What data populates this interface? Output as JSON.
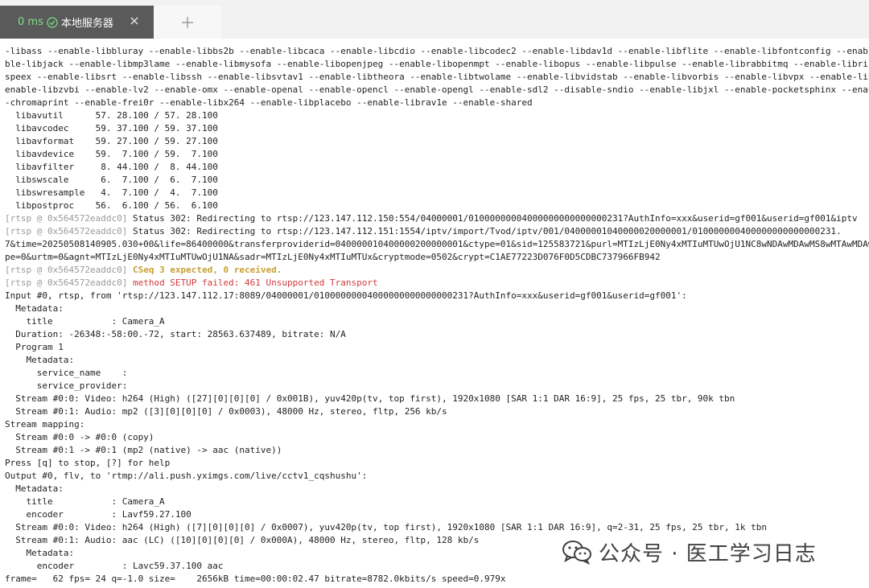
{
  "tab": {
    "latency": "0 ms",
    "label": "本地服务器",
    "close": "×"
  },
  "watermark": "公众号 · 医工学习日志",
  "colors": {
    "tab_bg": "#5a5a5a",
    "latency": "#7ee08a",
    "warn": "#c8a032",
    "error": "#d23a3a",
    "tag": "#9a9a9a"
  },
  "lines": [
    {
      "kind": "plain",
      "text": "-libass --enable-libbluray --enable-libbs2b --enable-libcaca --enable-libcdio --enable-libcodec2 --enable-libdav1d --enable-libflite --enable-libfontconfig --enabl"
    },
    {
      "kind": "plain",
      "text": "ble-libjack --enable-libmp3lame --enable-libmysofa --enable-libopenjpeg --enable-libopenmpt --enable-libopus --enable-libpulse --enable-librabbitmq --enable-libris"
    },
    {
      "kind": "plain",
      "text": "speex --enable-libsrt --enable-libssh --enable-libsvtav1 --enable-libtheora --enable-libtwolame --enable-libvidstab --enable-libvorbis --enable-libvpx --enable-lib"
    },
    {
      "kind": "plain",
      "text": "enable-libzvbi --enable-lv2 --enable-omx --enable-openal --enable-opencl --enable-opengl --enable-sdl2 --disable-sndio --enable-libjxl --enable-pocketsphinx --enab"
    },
    {
      "kind": "plain",
      "text": "-chromaprint --enable-frei0r --enable-libx264 --enable-libplacebo --enable-librav1e --enable-shared"
    },
    {
      "kind": "plain",
      "text": "  libavutil      57. 28.100 / 57. 28.100"
    },
    {
      "kind": "plain",
      "text": "  libavcodec     59. 37.100 / 59. 37.100"
    },
    {
      "kind": "plain",
      "text": "  libavformat    59. 27.100 / 59. 27.100"
    },
    {
      "kind": "plain",
      "text": "  libavdevice    59.  7.100 / 59.  7.100"
    },
    {
      "kind": "plain",
      "text": "  libavfilter     8. 44.100 /  8. 44.100"
    },
    {
      "kind": "plain",
      "text": "  libswscale      6.  7.100 /  6.  7.100"
    },
    {
      "kind": "plain",
      "text": "  libswresample   4.  7.100 /  4.  7.100"
    },
    {
      "kind": "plain",
      "text": "  libpostproc    56.  6.100 / 56.  6.100"
    },
    {
      "kind": "rtsp",
      "tag": "[rtsp @ 0x564572eaddc0]",
      "text": " Status 302: Redirecting to rtsp://123.147.112.150:554/04000001/01000000004000000000000000231?AuthInfo=xxx&userid=gf001&userid=gf001&iptv"
    },
    {
      "kind": "rtsp",
      "tag": "[rtsp @ 0x564572eaddc0]",
      "text": " Status 302: Redirecting to rtsp://123.147.112.151:1554/iptv/import/Tvod/iptv/001/04000001040000020000001/010000000400000000000000231."
    },
    {
      "kind": "plain",
      "text": "7&time=20250508140905.030+00&life=86400000&transferproviderid=040000010400000200000001&ctype=01&sid=125583721&purl=MTIzLjE0Ny4xMTIuMTUwOjU1NC8wNDAwMDAwMS8wMTAwMDAw"
    },
    {
      "kind": "plain",
      "text": "pe=0&urtm=0&agnt=MTIzLjE0Ny4xMTIuMTUwOjU1NA&sadr=MTIzLjE0Ny4xMTIuMTUx&cryptmode=0502&crypt=C1AE77223D076F0D5CDBC737966FB942"
    },
    {
      "kind": "warn",
      "tag": "[rtsp @ 0x564572eaddc0]",
      "text": " CSeq 3 expected, 0 received."
    },
    {
      "kind": "err",
      "tag": "[rtsp @ 0x564572eaddc0]",
      "text": " method SETUP failed: 461 Unsupported Transport"
    },
    {
      "kind": "plain",
      "text": "Input #0, rtsp, from 'rtsp://123.147.112.17:8089/04000001/01000000004000000000000000231?AuthInfo=xxx&userid=gf001&userid=gf001':"
    },
    {
      "kind": "plain",
      "text": "  Metadata:"
    },
    {
      "kind": "plain",
      "text": "    title           : Camera_A"
    },
    {
      "kind": "plain",
      "text": "  Duration: -26348:-58:00.-72, start: 28563.637489, bitrate: N/A"
    },
    {
      "kind": "plain",
      "text": "  Program 1"
    },
    {
      "kind": "plain",
      "text": "    Metadata:"
    },
    {
      "kind": "plain",
      "text": "      service_name    :"
    },
    {
      "kind": "plain",
      "text": "      service_provider:"
    },
    {
      "kind": "plain",
      "text": "  Stream #0:0: Video: h264 (High) ([27][0][0][0] / 0x001B), yuv420p(tv, top first), 1920x1080 [SAR 1:1 DAR 16:9], 25 fps, 25 tbr, 90k tbn"
    },
    {
      "kind": "plain",
      "text": "  Stream #0:1: Audio: mp2 ([3][0][0][0] / 0x0003), 48000 Hz, stereo, fltp, 256 kb/s"
    },
    {
      "kind": "plain",
      "text": "Stream mapping:"
    },
    {
      "kind": "plain",
      "text": "  Stream #0:0 -> #0:0 (copy)"
    },
    {
      "kind": "plain",
      "text": "  Stream #0:1 -> #0:1 (mp2 (native) -> aac (native))"
    },
    {
      "kind": "plain",
      "text": "Press [q] to stop, [?] for help"
    },
    {
      "kind": "plain",
      "text": "Output #0, flv, to 'rtmp://ali.push.yximgs.com/live/cctv1_cqshushu':"
    },
    {
      "kind": "plain",
      "text": "  Metadata:"
    },
    {
      "kind": "plain",
      "text": "    title           : Camera_A"
    },
    {
      "kind": "plain",
      "text": "    encoder         : Lavf59.27.100"
    },
    {
      "kind": "plain",
      "text": "  Stream #0:0: Video: h264 (High) ([7][0][0][0] / 0x0007), yuv420p(tv, top first), 1920x1080 [SAR 1:1 DAR 16:9], q=2-31, 25 fps, 25 tbr, 1k tbn"
    },
    {
      "kind": "plain",
      "text": "  Stream #0:1: Audio: aac (LC) ([10][0][0][0] / 0x000A), 48000 Hz, stereo, fltp, 128 kb/s"
    },
    {
      "kind": "plain",
      "text": "    Metadata:"
    },
    {
      "kind": "plain",
      "text": "      encoder         : Lavc59.37.100 aac"
    },
    {
      "kind": "plain",
      "text": "frame=   62 fps= 24 q=-1.0 size=    2656kB time=00:00:02.47 bitrate=8782.0kbits/s speed=0.979x"
    }
  ]
}
